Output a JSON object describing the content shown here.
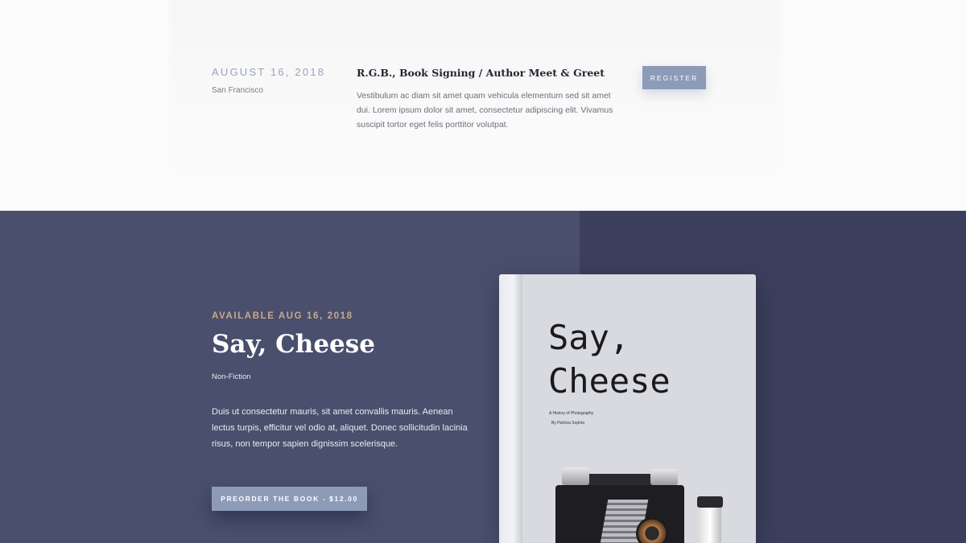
{
  "event": {
    "date": "AUGUST 16, 2018",
    "location": "San Francisco",
    "title": "R.G.B., Book Signing / Author Meet & Greet",
    "description": "Vestibulum ac diam sit amet quam vehicula elementum sed sit amet dui. Lorem ipsum dolor sit amet, consectetur adipiscing elit. Vivamus suscipit tortor eget felis porttitor volutpat.",
    "register_label": "REGISTER"
  },
  "book": {
    "available_label": "AVAILABLE AUG 16, 2018",
    "title": "Say, Cheese",
    "genre": "Non-Fiction",
    "description": "Duis ut consectetur mauris, sit amet convallis mauris. Aenean lectus turpis, efficitur vel odio at, aliquet. Donec sollicitudin lacinia risus, non tempor sapien dignissim scelerisque.",
    "preorder_label": "PREORDER THE BOOK - $12.00",
    "cover": {
      "title": "Say,\nCheese",
      "subtitle": "A History of Photography",
      "author": "By Patricia Sophia"
    }
  },
  "colors": {
    "accent": "#8d9bb9",
    "dark_bg": "#3b3f5c",
    "panel_bg": "#4a4f6d",
    "gold": "#c9a98a"
  }
}
